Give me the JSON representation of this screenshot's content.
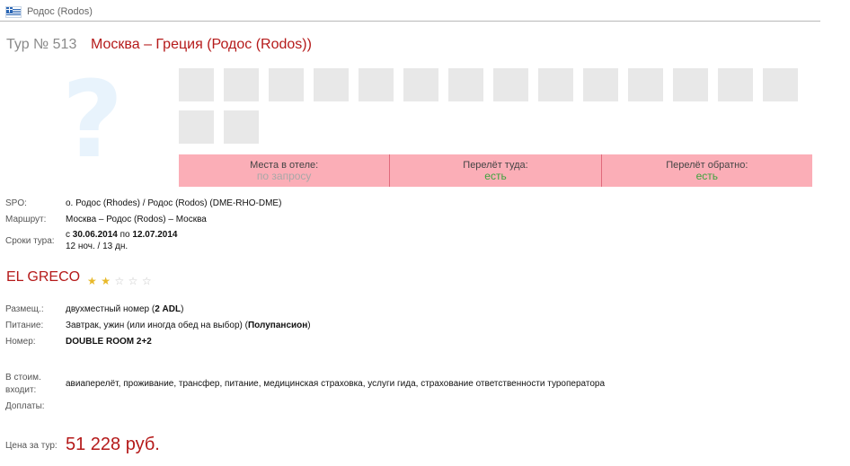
{
  "header": {
    "flag_icon": "greece-flag-icon",
    "location": "Родос (Rodos)"
  },
  "tour": {
    "number": "Тур № 513",
    "route": "Москва – Греция (Родос (Rodos))"
  },
  "availability": [
    {
      "label": "Места в отеле:",
      "value": "по запросу",
      "color": "#a8a8a8"
    },
    {
      "label": "Перелёт туда:",
      "value": "есть",
      "color": "#3ea33e"
    },
    {
      "label": "Перелёт обратно:",
      "value": "есть",
      "color": "#3ea33e"
    }
  ],
  "info": {
    "spo_label": "SPO:",
    "spo_value": "о. Родос (Rhodes) / Родос (Rodos) (DME-RHO-DME)",
    "route_label": "Маршрут:",
    "route_value": "Москва – Родос (Rodos) – Москва",
    "dates_label": "Сроки тура:",
    "dates_from_prefix": "с",
    "dates_from": "30.06.2014",
    "dates_to_prefix": "по",
    "dates_to": "12.07.2014",
    "duration": "12 ноч. / 13 дн."
  },
  "hotel": {
    "name": "EL GRECO",
    "stars_total": 5,
    "stars_filled": 2
  },
  "room": {
    "placement_label": "Размещ.:",
    "placement_value": "двухместный номер (",
    "placement_bold": "2 ADL",
    "placement_close": ")",
    "meals_label": "Питание:",
    "meals_value": "Завтрак, ужин (или иногда обед на выбор) (",
    "meals_bold": "Полупансион",
    "meals_close": ")",
    "room_label": "Номер:",
    "room_value": "DOUBLE ROOM 2+2"
  },
  "includes": {
    "label_line1": "В стоим.",
    "label_line2": "входит:",
    "value": "авиаперелёт, проживание, трансфер, питание, медицинская страховка, услуги гида, страхование ответственности туроператора",
    "extras_label": "Доплаты:"
  },
  "price": {
    "label": "Цена за тур:",
    "value": "51 228 руб."
  },
  "colors": {
    "accent": "#b51a1a",
    "availability_bg": "#fbaeb7",
    "thumb_placeholder": "#e8e8e8"
  }
}
